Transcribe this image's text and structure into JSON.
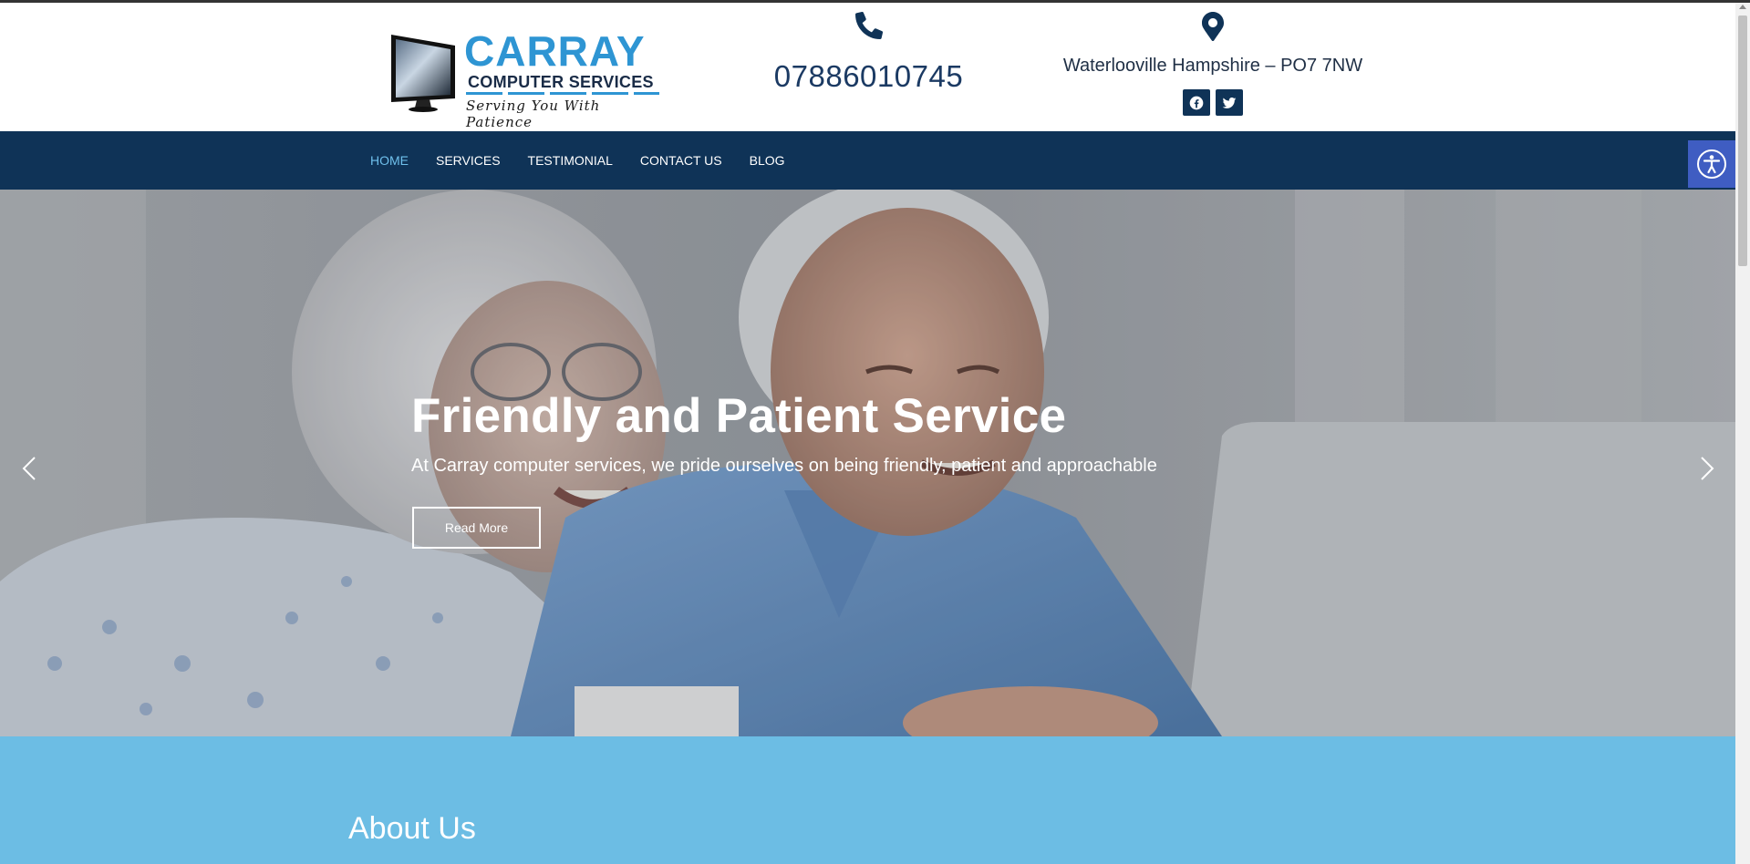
{
  "brand": {
    "name": "CARRAY",
    "subtitle": "COMPUTER SERVICES",
    "tagline": "Serving You With Patience",
    "primary_color": "#2e95d3",
    "nav_color": "#0f3357"
  },
  "contact": {
    "phone": "07886010745",
    "phone_icon": "phone-icon",
    "location": "Waterlooville Hampshire – PO7 7NW",
    "location_icon": "map-pin-icon",
    "social": [
      {
        "name": "facebook-icon"
      },
      {
        "name": "twitter-icon"
      }
    ]
  },
  "nav": {
    "items": [
      {
        "label": "HOME",
        "active": true
      },
      {
        "label": "SERVICES",
        "active": false
      },
      {
        "label": "TESTIMONIAL",
        "active": false
      },
      {
        "label": "CONTACT US",
        "active": false
      },
      {
        "label": "BLOG",
        "active": false
      }
    ],
    "accessibility_icon": "accessibility-icon"
  },
  "hero": {
    "title": "Friendly and Patient Service",
    "subtitle": "At Carray computer services, we pride ourselves on being friendly, patient and approachable",
    "button_label": "Read More",
    "prev_icon": "chevron-left-icon",
    "next_icon": "chevron-right-icon"
  },
  "about": {
    "title": "About Us",
    "bg_color": "#6cbde4"
  }
}
